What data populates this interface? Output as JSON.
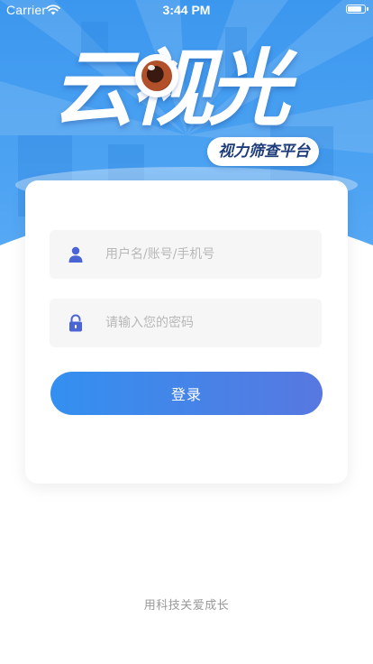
{
  "status_bar": {
    "carrier": "Carrier",
    "time": "3:44 PM",
    "battery_level": 0.9
  },
  "brand": {
    "logo_text": "云视光",
    "tagline": "视力筛查平台",
    "primary_color": "#3d9bf0",
    "accent_color": "#5778e0"
  },
  "login_form": {
    "username_placeholder": "用户名/账号/手机号",
    "username_value": "",
    "password_placeholder": "请输入您的密码",
    "password_value": "",
    "submit_label": "登录",
    "user_icon": "user-icon",
    "lock_icon": "lock-icon"
  },
  "footer": {
    "slogan": "用科技关爱成长"
  }
}
